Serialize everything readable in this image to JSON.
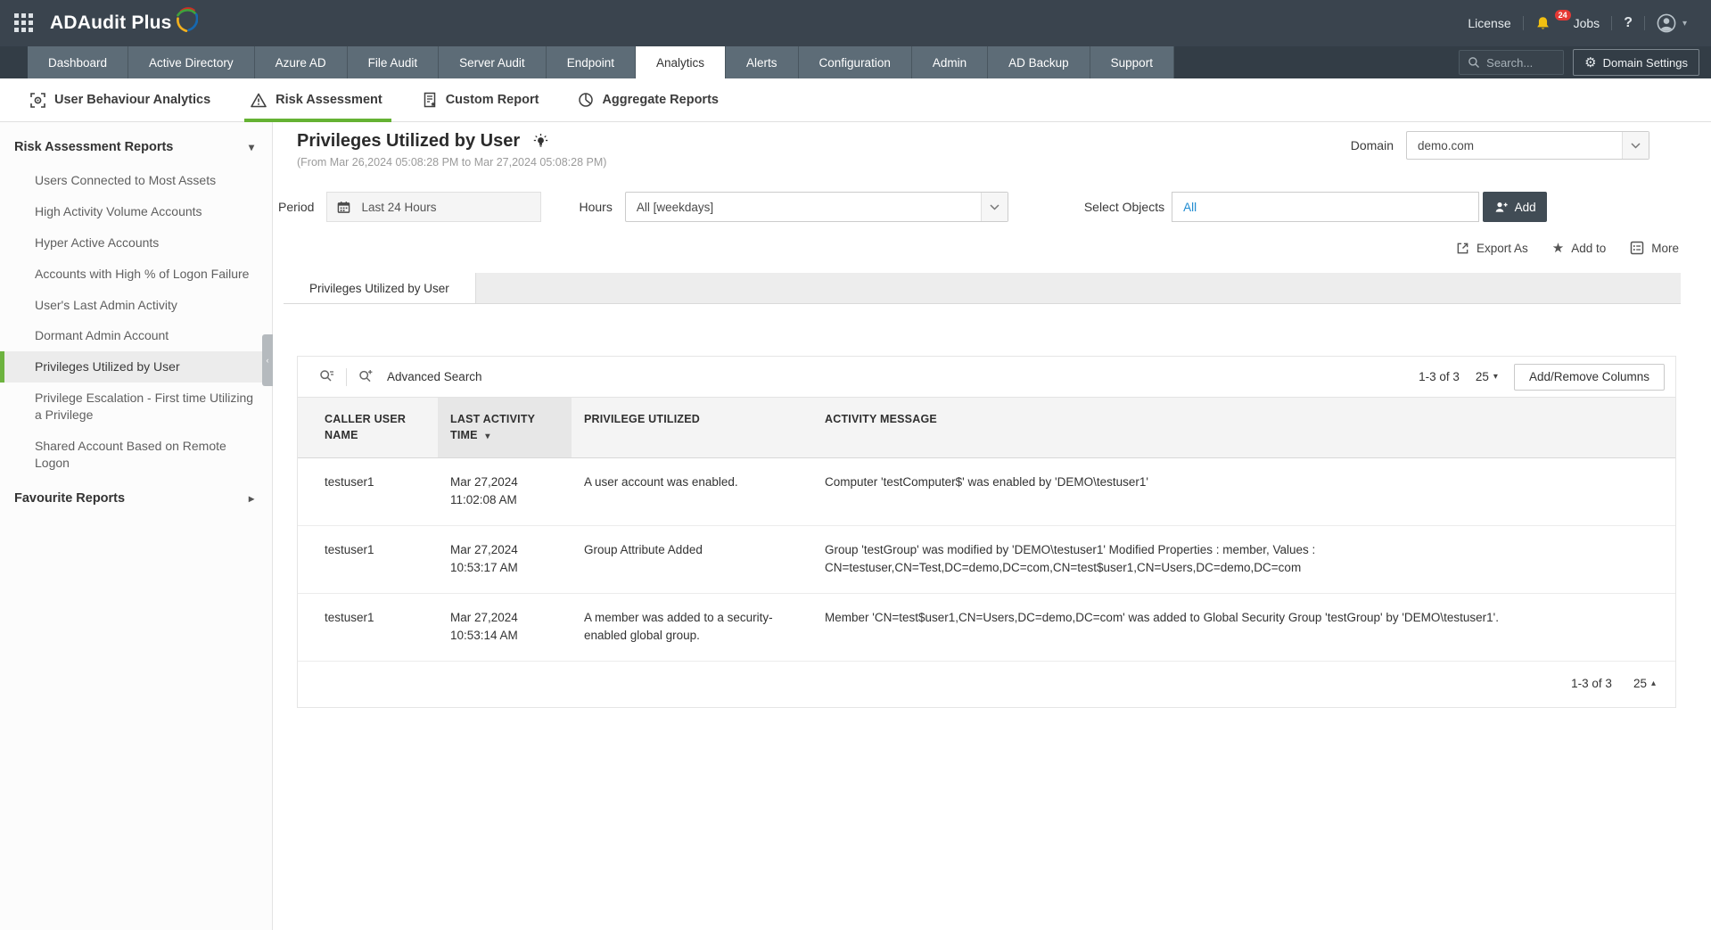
{
  "topbar": {
    "logo_text": "ADAudit Plus",
    "license": "License",
    "notifications_badge": "24",
    "jobs": "Jobs",
    "help": "?"
  },
  "nav": {
    "tabs": [
      {
        "label": "Dashboard",
        "active": false
      },
      {
        "label": "Active Directory",
        "active": false
      },
      {
        "label": "Azure AD",
        "active": false
      },
      {
        "label": "File Audit",
        "active": false
      },
      {
        "label": "Server Audit",
        "active": false
      },
      {
        "label": "Endpoint",
        "active": false
      },
      {
        "label": "Analytics",
        "active": true
      },
      {
        "label": "Alerts",
        "active": false
      },
      {
        "label": "Configuration",
        "active": false
      },
      {
        "label": "Admin",
        "active": false
      },
      {
        "label": "AD Backup",
        "active": false
      },
      {
        "label": "Support",
        "active": false
      }
    ],
    "search_placeholder": "Search...",
    "domain_settings": "Domain Settings"
  },
  "subnav": {
    "items": [
      {
        "label": "User Behaviour Analytics",
        "icon": "user-behaviour-analytics-icon",
        "active": false
      },
      {
        "label": "Risk Assessment",
        "icon": "risk-assessment-icon",
        "active": true
      },
      {
        "label": "Custom Report",
        "icon": "custom-report-icon",
        "active": false
      },
      {
        "label": "Aggregate Reports",
        "icon": "aggregate-reports-icon",
        "active": false
      }
    ]
  },
  "sidebar": {
    "section_title": "Risk Assessment Reports",
    "items": [
      {
        "label": "Users Connected to Most Assets",
        "selected": false
      },
      {
        "label": "High Activity Volume Accounts",
        "selected": false
      },
      {
        "label": "Hyper Active Accounts",
        "selected": false
      },
      {
        "label": "Accounts with High % of Logon Failure",
        "selected": false
      },
      {
        "label": "User's Last Admin Activity",
        "selected": false
      },
      {
        "label": "Dormant Admin Account",
        "selected": false
      },
      {
        "label": "Privileges Utilized by User",
        "selected": true
      },
      {
        "label": "Privilege Escalation - First time Utilizing a Privilege",
        "selected": false
      },
      {
        "label": "Shared Account Based on Remote Logon",
        "selected": false
      }
    ],
    "favourites": "Favourite Reports"
  },
  "header": {
    "title": "Privileges Utilized by User",
    "date_range": "(From Mar 26,2024 05:08:28 PM to Mar 27,2024 05:08:28 PM)",
    "domain_label": "Domain",
    "domain_value": "demo.com"
  },
  "filters": {
    "period_label": "Period",
    "period_value": "Last 24 Hours",
    "hours_label": "Hours",
    "hours_value": "All [weekdays]",
    "select_objects_label": "Select Objects",
    "select_objects_value": "All",
    "add_button": "Add"
  },
  "actions": {
    "export_as": "Export As",
    "add_to": "Add to",
    "more": "More"
  },
  "report": {
    "tab_label": "Privileges Utilized by User",
    "advanced_search": "Advanced Search",
    "top_pagination": {
      "range": "1-3 of 3",
      "page_size": "25"
    },
    "add_remove_columns": "Add/Remove Columns",
    "bottom_pagination": {
      "range": "1-3 of 3",
      "page_size": "25"
    }
  },
  "table": {
    "columns": [
      {
        "label": "CALLER USER NAME",
        "sorted": false
      },
      {
        "label": "LAST ACTIVITY TIME",
        "sorted": "desc"
      },
      {
        "label": "PRIVILEGE UTILIZED",
        "sorted": false
      },
      {
        "label": "ACTIVITY MESSAGE",
        "sorted": false
      }
    ],
    "rows": [
      {
        "caller_user_name": "testuser1",
        "last_activity_time": "Mar 27,2024 11:02:08 AM",
        "privilege_utilized": "A user account was enabled.",
        "activity_message": "Computer 'testComputer$' was enabled by 'DEMO\\testuser1'"
      },
      {
        "caller_user_name": "testuser1",
        "last_activity_time": "Mar 27,2024 10:53:17 AM",
        "privilege_utilized": "Group Attribute Added",
        "activity_message": "Group 'testGroup' was modified by 'DEMO\\testuser1' Modified Properties : member, Values : CN=testuser,CN=Test,DC=demo,DC=com,CN=test$user1,CN=Users,DC=demo,DC=com"
      },
      {
        "caller_user_name": "testuser1",
        "last_activity_time": "Mar 27,2024 10:53:14 AM",
        "privilege_utilized": "A member was added to a security-enabled global group.",
        "activity_message": "Member 'CN=test$user1,CN=Users,DC=demo,DC=com' was added to Global Security Group 'testGroup' by 'DEMO\\testuser1'."
      }
    ]
  },
  "glyphs": {
    "chevron_down": "▾",
    "chevron_right": "▸",
    "chevron_up": "▴",
    "chevron_left": "‹",
    "gear": "⚙",
    "star": "★"
  },
  "colors": {
    "topbar_bg": "#3a444e",
    "nav_tab_bg": "#5d6c77",
    "accent_green": "#6db33f",
    "link_blue": "#1e8bd1",
    "add_button_bg": "#414c55",
    "bell_yellow": "#f2c011",
    "badge_red": "#e53935"
  }
}
